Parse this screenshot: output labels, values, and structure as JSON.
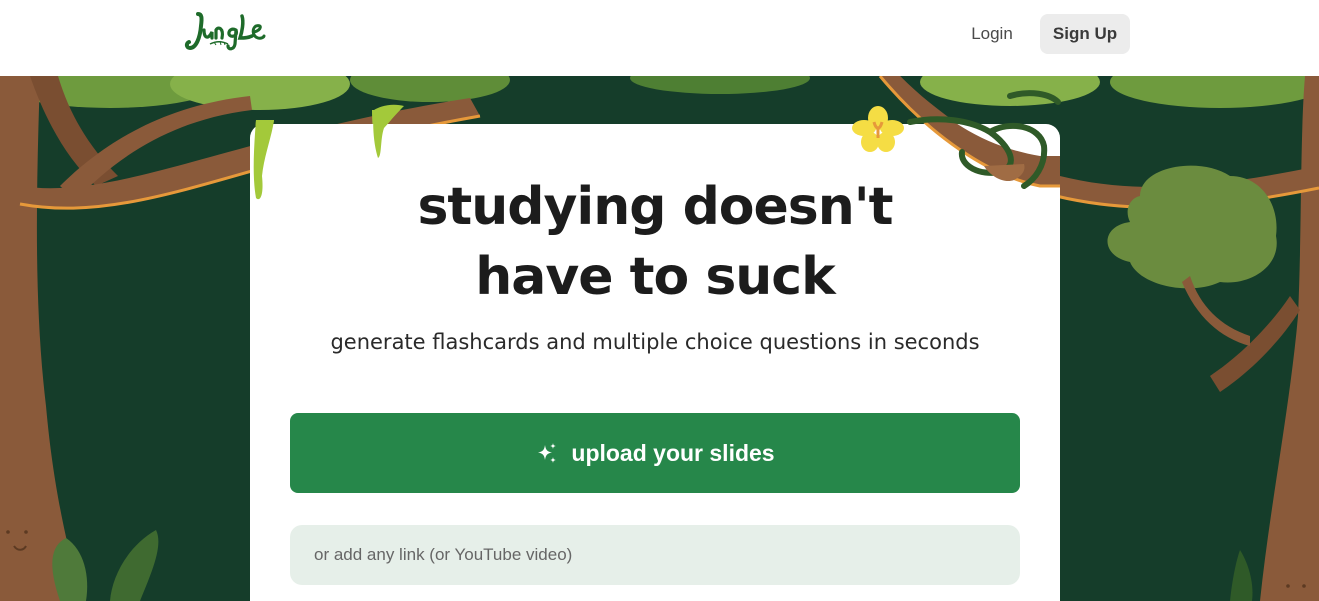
{
  "header": {
    "logo_alt": "Jungle",
    "login_label": "Login",
    "signup_label": "Sign Up"
  },
  "hero": {
    "headline_line1": "studying doesn't",
    "headline_line2": "have to suck",
    "subheadline": "generate flashcards and multiple choice questions in seconds",
    "upload_button_label": "upload your slides",
    "upload_icon": "sparkle-icon",
    "link_input": {
      "placeholder": "or add any link (or YouTube video)",
      "value": ""
    }
  },
  "colors": {
    "brand_green": "#1e6b2a",
    "button_green": "#26874a",
    "jungle_dark": "#153d2a",
    "signup_bg": "#ececec",
    "input_bg": "#e6efe9",
    "trunk_brown": "#8a5a3a",
    "vine_orange": "#e6993a",
    "leaf_green": "#77a648",
    "flower_yellow": "#f5dd44"
  }
}
